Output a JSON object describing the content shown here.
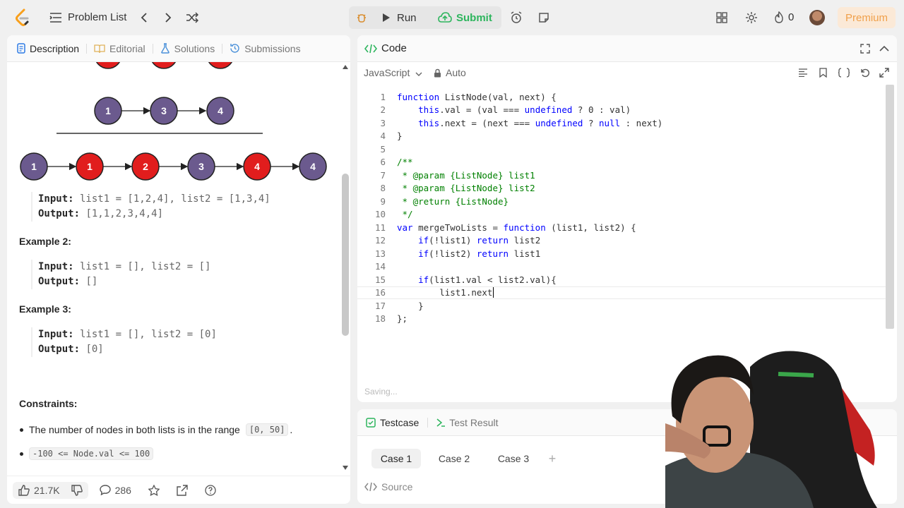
{
  "topbar": {
    "problem_list": "Problem List",
    "run": "Run",
    "submit": "Submit",
    "streak_count": "0",
    "premium": "Premium"
  },
  "left_tabs": [
    {
      "label": "Description",
      "icon": "description-icon"
    },
    {
      "label": "Editorial",
      "icon": "editorial-icon"
    },
    {
      "label": "Solutions",
      "icon": "flask-icon"
    },
    {
      "label": "Submissions",
      "icon": "history-icon"
    }
  ],
  "diagram": {
    "list_top": [
      "1",
      "3",
      "4"
    ],
    "merged": [
      "1",
      "1",
      "2",
      "3",
      "4",
      "4"
    ]
  },
  "examples": {
    "ex1_input_label": "Input:",
    "ex1_input": " list1 = [1,2,4], list2 = [1,3,4]",
    "ex1_output_label": "Output:",
    "ex1_output": " [1,1,2,3,4,4]",
    "ex2_title": "Example 2:",
    "ex2_input_label": "Input:",
    "ex2_input": " list1 = [], list2 = []",
    "ex2_output_label": "Output:",
    "ex2_output": " []",
    "ex3_title": "Example 3:",
    "ex3_input_label": "Input:",
    "ex3_input": " list1 = [], list2 = [0]",
    "ex3_output_label": "Output:",
    "ex3_output": " [0]"
  },
  "constraints": {
    "title": "Constraints:",
    "c1_text": "The number of nodes in both lists is in the range",
    "c1_code": "[0, 50]",
    "c1_end": ".",
    "c2_code": "-100 <= Node.val <= 100"
  },
  "left_footer": {
    "likes": "21.7K",
    "comments": "286"
  },
  "code": {
    "title": "Code",
    "language": "JavaScript",
    "mode": "Auto",
    "saving": "Saving...",
    "lines": [
      "function ListNode(val, next) {",
      "    this.val = (val === undefined ? 0 : val)",
      "    this.next = (next === undefined ? null : next)",
      "}",
      "",
      "/**",
      " * @param {ListNode} list1",
      " * @param {ListNode} list2",
      " * @return {ListNode}",
      " */",
      "var mergeTwoLists = function (list1, list2) {",
      "    if(!list1) return list2",
      "    if(!list2) return list1",
      "",
      "    if(list1.val < list2.val){",
      "        list1.next",
      "    }",
      "};"
    ]
  },
  "testcase": {
    "tab_testcase": "Testcase",
    "tab_result": "Test Result",
    "cases": [
      "Case 1",
      "Case 2",
      "Case 3"
    ],
    "add": "+",
    "source": "Source"
  },
  "colors": {
    "node_purple": "#6b5a8e",
    "node_red": "#e11d1d",
    "accent_green": "#2db55d",
    "premium_orange": "#f0a04b"
  }
}
